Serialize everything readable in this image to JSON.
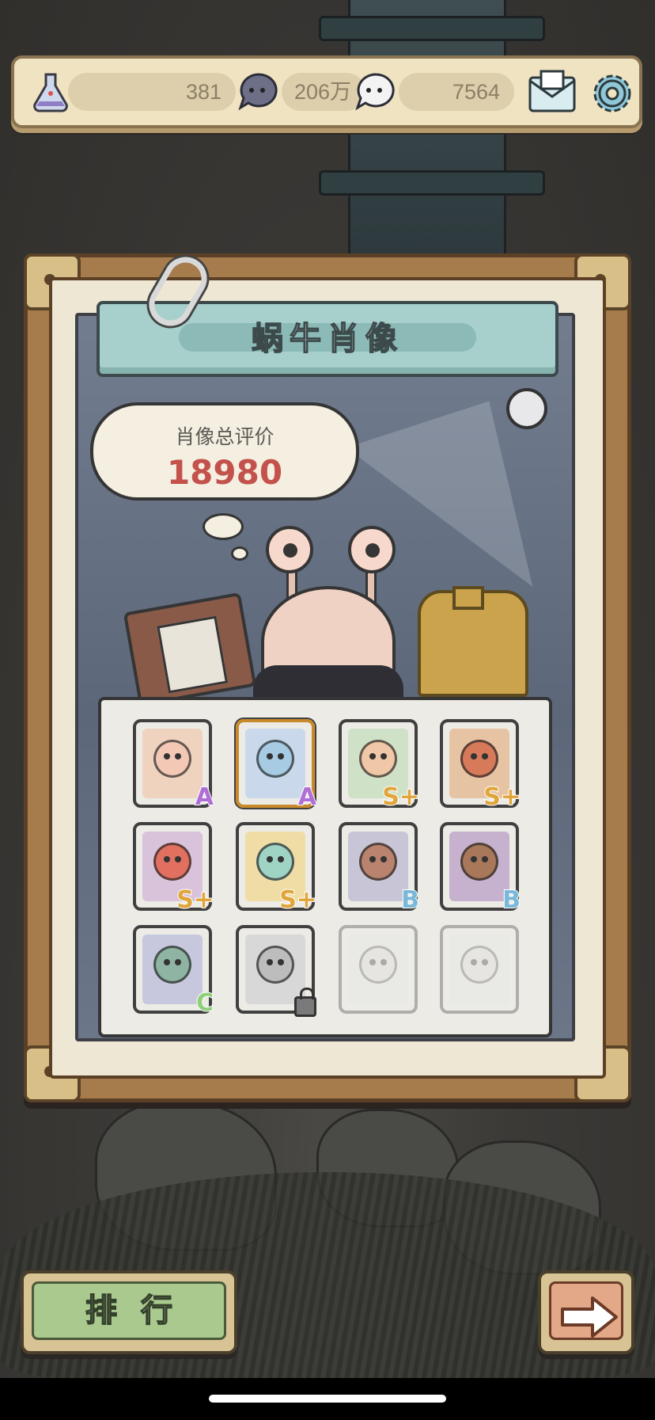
{
  "resources": {
    "potion_count": "381",
    "dark_bubble_count": "206万",
    "light_bubble_count": "7564"
  },
  "panel": {
    "title": "蜗牛肖像",
    "rating_label": "肖像总评价",
    "rating_value": "18980"
  },
  "cards": [
    {
      "name": "snail-portrait-card",
      "grade": "A",
      "grade_color": "#b06fd6",
      "state": "owned",
      "art_color": "#efd3bf",
      "face_color": "#f3c9b5"
    },
    {
      "name": "blue-hair-girl-card",
      "grade": "A",
      "grade_color": "#b06fd6",
      "state": "owned-highlight",
      "art_color": "#c9d8ea",
      "face_color": "#a6cbe3"
    },
    {
      "name": "sunglasses-guy-card",
      "grade": "S+",
      "grade_color": "#e0a53c",
      "state": "owned",
      "art_color": "#cfe1c7",
      "face_color": "#f0c8a8"
    },
    {
      "name": "bearded-warrior-card",
      "grade": "S+",
      "grade_color": "#e0a53c",
      "state": "owned",
      "art_color": "#e6c4a3",
      "face_color": "#d77a5a"
    },
    {
      "name": "red-crab-monster-card",
      "grade": "S+",
      "grade_color": "#e0a53c",
      "state": "owned",
      "art_color": "#d8c3da",
      "face_color": "#e27060"
    },
    {
      "name": "rainbow-gem-card",
      "grade": "S+",
      "grade_color": "#e0a53c",
      "state": "owned",
      "art_color": "#f0dda6",
      "face_color": "#9fd3c4"
    },
    {
      "name": "brain-mask-card",
      "grade": "B",
      "grade_color": "#79b8d8",
      "state": "owned",
      "art_color": "#c8c6d6",
      "face_color": "#b9836f"
    },
    {
      "name": "owl-creature-card",
      "grade": "B",
      "grade_color": "#79b8d8",
      "state": "owned",
      "art_color": "#c6b2cf",
      "face_color": "#a9785b"
    },
    {
      "name": "bronze-vessel-card",
      "grade": "C",
      "grade_color": "#8fcf7a",
      "state": "owned",
      "art_color": "#c7c8de",
      "face_color": "#8fb4a3"
    },
    {
      "name": "locked-rock-card",
      "grade": "",
      "grade_color": "#7a7a7a",
      "state": "locked",
      "art_color": "#d8d8d8",
      "face_color": "#bdbdbd"
    },
    {
      "name": "unknown-card-11",
      "grade": "",
      "grade_color": "#cccccc",
      "state": "hidden",
      "art_color": "#e6e6e6",
      "face_color": "#dcdcdc"
    },
    {
      "name": "unknown-card-12",
      "grade": "",
      "grade_color": "#cccccc",
      "state": "hidden",
      "art_color": "#e6e6e6",
      "face_color": "#dcdcdc"
    }
  ],
  "buttons": {
    "rank_label": "排行",
    "next_icon": "arrow-right-icon"
  },
  "icons": {
    "potion": "potion-flask-icon",
    "dark_bubble": "dark-speech-bubble-icon",
    "light_bubble": "light-speech-bubble-icon",
    "mail": "mail-icon",
    "settings": "gear-icon"
  },
  "colors": {
    "accent_red": "#c4524c",
    "title_banner": "#a7cfcb",
    "rank_button": "#a9c98e",
    "next_button": "#e3a887"
  }
}
